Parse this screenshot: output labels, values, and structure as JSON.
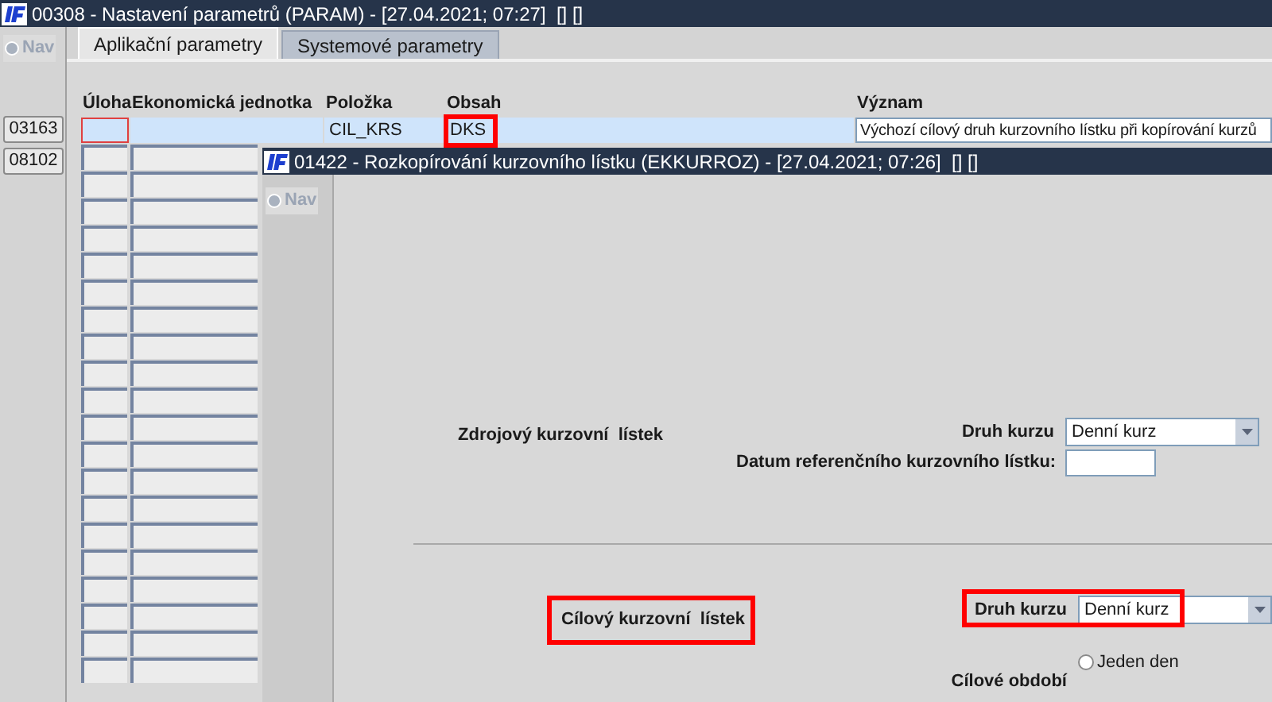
{
  "main_window": {
    "title": "00308 - Nastavení parametrů (PARAM) - [27.04.2021; 07:27]  [] []",
    "nav": "Nav",
    "tabs": [
      {
        "label": "Aplikační parametry",
        "selected": true
      },
      {
        "label": "Systemové parametry",
        "selected": false
      }
    ],
    "side_buttons": [
      "03163",
      "08102"
    ],
    "table": {
      "columns": [
        "Úloha",
        "Ekonomická jednotka",
        "Položka",
        "Obsah",
        "Význam"
      ],
      "rows": [
        {
          "cells": [
            {
              "focused": true
            },
            {},
            {
              "text": "CIL_KRS"
            },
            {
              "text": "DKS",
              "highlighted": true
            },
            {
              "text": "Výchozí cílový druh kurzovního lístku při kopírování kurzů"
            }
          ]
        }
      ]
    }
  },
  "inner_window": {
    "title": "01422 - Rozkopírování kurzovního lístku (EKKURROZ) - [27.04.2021; 07:26]  [] []",
    "nav": "Nav",
    "sections": [
      {
        "title": "Zdrojový kurzovní  lístek",
        "fields": [
          {
            "kind": "select",
            "label": "Druh kurzu",
            "value": "Denní kurz"
          },
          {
            "kind": "text",
            "label": "Datum referenčního kurzovního lístku:"
          }
        ]
      },
      {
        "title": "Cílový kurzovní  lístek",
        "highlighted": true,
        "fields": [
          {
            "kind": "select",
            "label": "Druh kurzu",
            "value": "Denní kurz",
            "highlighted": true
          },
          {
            "kind": "radio",
            "label": "Cílové období",
            "options": [
              {
                "label": "Jeden den",
                "selected": false
              }
            ]
          }
        ]
      }
    ]
  }
}
